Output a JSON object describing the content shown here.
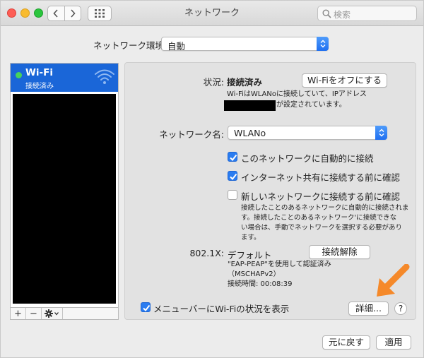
{
  "window": {
    "title": "ネットワーク"
  },
  "search": {
    "placeholder": "検索"
  },
  "location": {
    "label": "ネットワーク環境:",
    "value": "自動"
  },
  "sidebar": {
    "items": [
      {
        "name": "Wi-Fi",
        "status": "接続済み"
      }
    ],
    "toolbar": {
      "add": "+",
      "remove": "−"
    }
  },
  "status": {
    "label": "状況:",
    "value": "接続済み",
    "toggle_button": "Wi-Fiをオフにする",
    "desc_line1": "Wi-FiはWLANoに接続していて、IPアドレス",
    "desc_line2": "が設定されています。"
  },
  "network_name": {
    "label": "ネットワーク名:",
    "value": "WLANo"
  },
  "options": [
    {
      "label": "このネットワークに自動的に接続",
      "checked": true
    },
    {
      "label": "インターネット共有に接続する前に確認",
      "checked": true
    },
    {
      "label": "新しいネットワークに接続する前に確認",
      "checked": false
    }
  ],
  "help_text": {
    "line1": "接続したことのあるネットワークに自動的に接続されま",
    "line2": "す。接続したことのあるネットワーク'に接続できな",
    "line3": "い場合は、手動でネットワークを選択する必要があり",
    "line4": "ます。"
  },
  "dot1x": {
    "label": "802.1X:",
    "value": "デフォルト",
    "disconnect_button": "接続解除",
    "info_line1": "\"EAP-PEAP\"を使用して認証済み",
    "info_line2": "（MSCHAPv2）",
    "info_line3": "接続時間: 00:08:39"
  },
  "menubar_option": {
    "label": "メニューバーにWi-Fiの状況を表示",
    "checked": true
  },
  "advanced_button": "詳細...",
  "help_button": "?",
  "revert_button": "元に戻す",
  "apply_button": "適用",
  "colors": {
    "accent": "#1a66d8",
    "arrow": "#f5892a",
    "connected": "#47d25b"
  }
}
